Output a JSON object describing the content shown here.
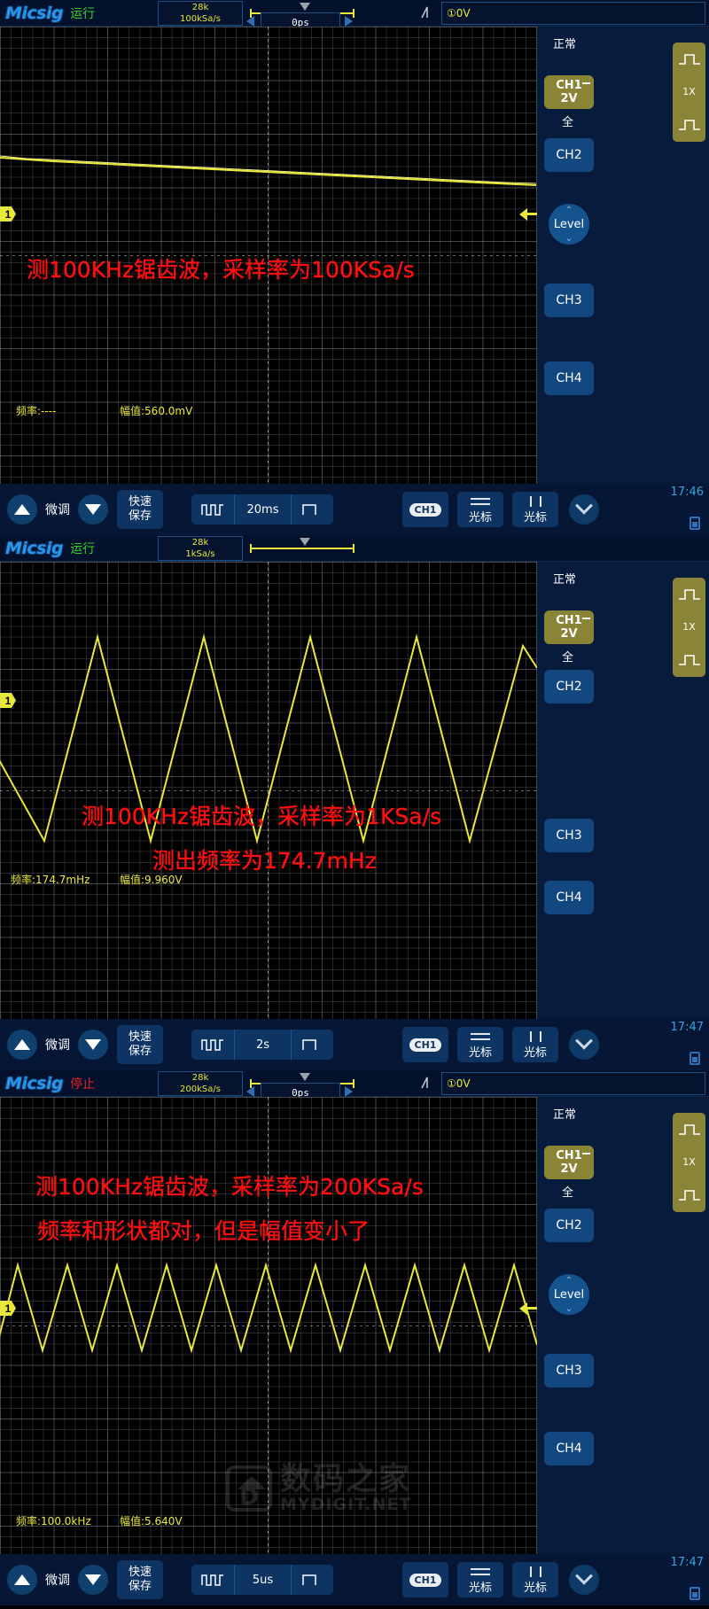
{
  "panels": [
    {
      "id": "panel-1",
      "brand": "Micsig",
      "run_state": "运行",
      "run_state_color": "#39d02a",
      "mem_depth": "28k",
      "sample_rate": "100kSa/s",
      "h_position": "0ps",
      "trigger_source": "①0V",
      "trigger_mode": "正常",
      "channel": "CH1",
      "channel_scale": "2V",
      "coupling": "全",
      "probe": "1X",
      "side_buttons": [
        "CH2",
        "Level",
        "CH3",
        "CH4"
      ],
      "annotation_lines": [
        "测100KHz锯齿波，采样率为100KSa/s"
      ],
      "meas_freq": "频率:----",
      "meas_ampl": "幅值:560.0mV",
      "toolbar": {
        "tune_label": "微调",
        "quick_save": "快速\n保存",
        "quick_save_l1": "快速",
        "quick_save_l2": "保存",
        "timebase": "20ms",
        "channel_pill": "CH1",
        "cursor_h": "光标",
        "cursor_v": "光标"
      },
      "clock": "17:46",
      "has_level_knob": true,
      "has_trigger_box": true,
      "watermark": null
    },
    {
      "id": "panel-2",
      "brand": "Micsig",
      "run_state": "运行",
      "run_state_color": "#39d02a",
      "mem_depth": "28k",
      "sample_rate": "1kSa/s",
      "h_position": "",
      "trigger_source": "",
      "trigger_mode": "正常",
      "channel": "CH1",
      "channel_scale": "2V",
      "coupling": "全",
      "probe": "1X",
      "side_buttons": [
        "CH2",
        "CH3",
        "CH4"
      ],
      "annotation_lines": [
        "测100KHz锯齿波，采样率为1KSa/s",
        "测出频率为174.7mHz"
      ],
      "meas_freq": "频率:174.7mHz",
      "meas_ampl": "幅值:9.960V",
      "toolbar": {
        "tune_label": "微调",
        "quick_save_l1": "快速",
        "quick_save_l2": "保存",
        "timebase": "2s",
        "channel_pill": "CH1",
        "cursor_h": "光标",
        "cursor_v": "光标"
      },
      "clock": "17:47",
      "has_level_knob": false,
      "has_trigger_box": false,
      "watermark": null
    },
    {
      "id": "panel-3",
      "brand": "Micsig",
      "run_state": "停止",
      "run_state_color": "#ee2222",
      "mem_depth": "28k",
      "sample_rate": "200kSa/s",
      "h_position": "0ps",
      "trigger_source": "①0V",
      "trigger_mode": "正常",
      "channel": "CH1",
      "channel_scale": "2V",
      "coupling": "全",
      "probe": "1X",
      "side_buttons": [
        "CH2",
        "Level",
        "CH3",
        "CH4"
      ],
      "annotation_lines": [
        "测100KHz锯齿波，采样率为200KSa/s",
        "频率和形状都对，但是幅值变小了"
      ],
      "meas_freq": "频率:100.0kHz",
      "meas_ampl": "幅值:5.640V",
      "toolbar": {
        "tune_label": "微调",
        "quick_save_l1": "快速",
        "quick_save_l2": "保存",
        "timebase": "5us",
        "channel_pill": "CH1",
        "cursor_h": "光标",
        "cursor_v": "光标"
      },
      "clock": "17:47",
      "has_level_knob": true,
      "has_trigger_box": true,
      "watermark": {
        "cn": "数码之家",
        "en": "MYDIGIT.NET"
      }
    }
  ],
  "colors": {
    "trace": "#e8e83c",
    "annotation": "#ff1111",
    "brand": "#2a95e8",
    "panel_bg": "#071b3d",
    "button": "#13477f",
    "active_button": "#8a8536"
  }
}
